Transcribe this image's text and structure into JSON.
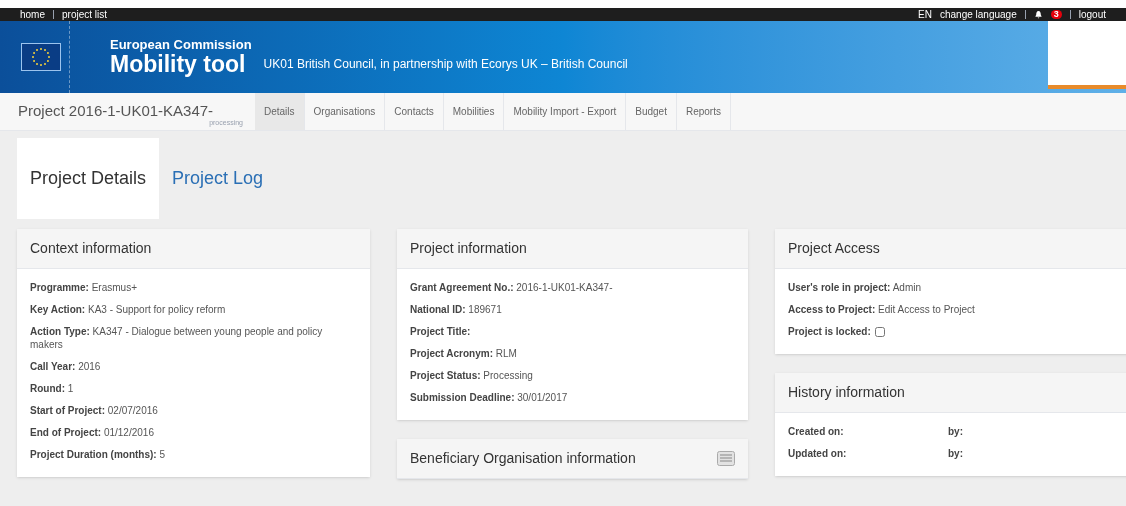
{
  "top_bar": {
    "left_links": [
      "home",
      "project list"
    ],
    "language": "EN",
    "change_language": "change language",
    "notifications": "3",
    "logout": "logout"
  },
  "header": {
    "org": "European Commission",
    "app": "Mobility tool",
    "agency": "UK01 British Council, in partnership with Ecorys UK – British Council"
  },
  "project_bar": {
    "project": "Project 2016-1-UK01-KA347-",
    "status": "processing",
    "tabs": [
      {
        "label": "Details",
        "selected": true
      },
      {
        "label": "Organisations",
        "selected": false
      },
      {
        "label": "Contacts",
        "selected": false
      },
      {
        "label": "Mobilities",
        "selected": false
      },
      {
        "label": "Mobility Import - Export",
        "selected": false
      },
      {
        "label": "Budget",
        "selected": false
      },
      {
        "label": "Reports",
        "selected": false
      }
    ]
  },
  "page_tabs": [
    {
      "label": "Project Details",
      "selected": true
    },
    {
      "label": "Project Log",
      "selected": false
    }
  ],
  "columns": [
    [
      {
        "title": "Context information",
        "fields": [
          "**Programme:** Erasmus+",
          "**Key Action:** KA3 - Support for policy reform",
          "**Action Type:** KA347 - Dialogue between young people and policy makers",
          "**Call Year:** 2016",
          "**Round:** 1",
          "**Start of Project:** 02/07/2016",
          "**End of Project:** 01/12/2016",
          "**Project Duration (months):** 5"
        ]
      }
    ],
    [
      {
        "title": "Project information",
        "fields": [
          "**Grant Agreement No.:** 2016-1-UK01-KA347-",
          "**National ID:** 189671",
          "**Project Title:**",
          "**Project Acronym:** RLM",
          "**Project Status:** Processing",
          "**Submission Deadline:** 30/01/2017"
        ]
      },
      {
        "title": "Beneficiary Organisation information",
        "has_list_button": true
      }
    ],
    [
      {
        "title": "Project Access",
        "fields": [
          "**User's role in project:** Admin",
          "**Access to Project:** Edit Access to Project"
        ],
        "locked": {
          "label": "Project is locked:",
          "checked": false
        }
      },
      {
        "title": "History information",
        "history": [
          {
            "label": "Created on:",
            "by": "by:"
          },
          {
            "label": "Updated on:",
            "by": "by:"
          }
        ]
      }
    ]
  ]
}
